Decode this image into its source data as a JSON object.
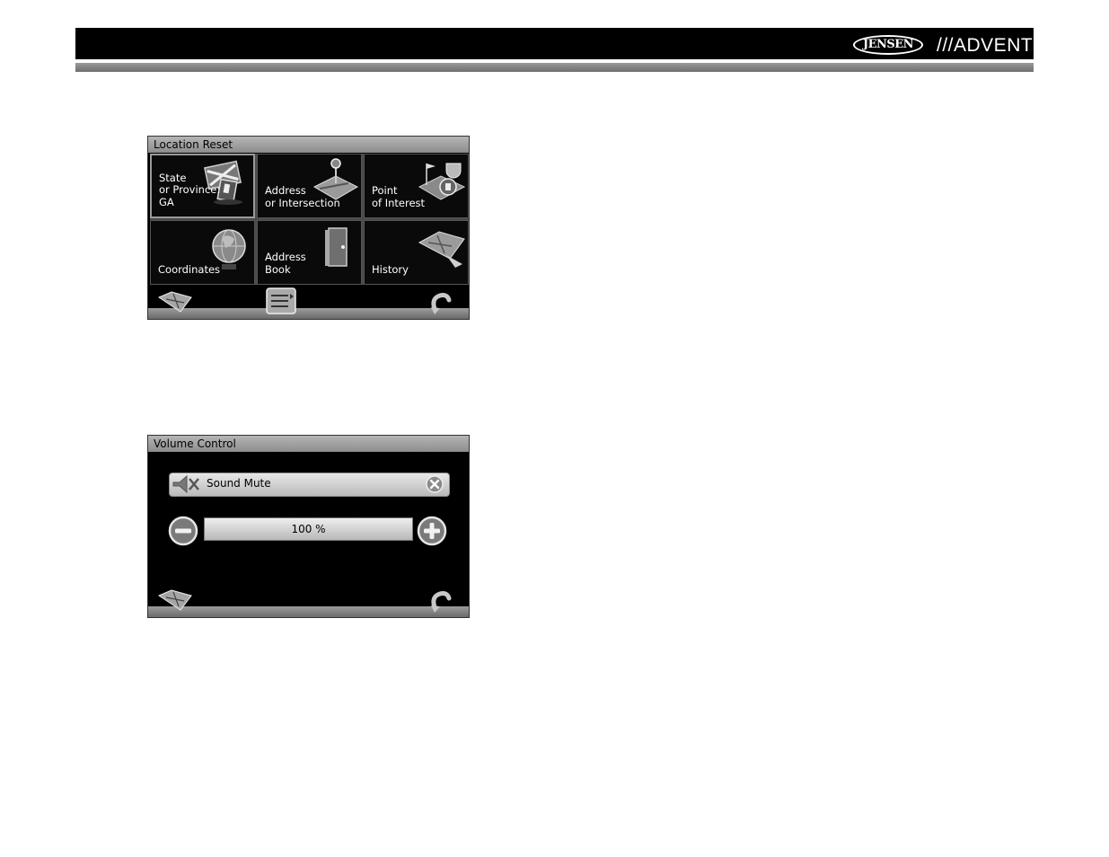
{
  "header": {
    "brand_left": "JENSEN",
    "brand_right": "///ADVENT"
  },
  "location_reset": {
    "title": "Location Reset",
    "tiles": [
      {
        "label": "State\nor Province:\nGA",
        "icon": "flag-icon",
        "selected": true
      },
      {
        "label": "Address\nor Intersection",
        "icon": "map-pin-icon",
        "selected": false
      },
      {
        "label": "Point\nof Interest",
        "icon": "poi-icon",
        "selected": false
      },
      {
        "label": "Coordinates",
        "icon": "globe-icon",
        "selected": false
      },
      {
        "label": "Address\nBook",
        "icon": "book-icon",
        "selected": false
      },
      {
        "label": "History",
        "icon": "map-history-icon",
        "selected": false
      }
    ],
    "bottom_icons": [
      "map-icon",
      "list-icon",
      "back-arrow-icon"
    ]
  },
  "volume_control": {
    "title": "Volume Control",
    "mute_label": "Sound Mute",
    "volume_text": "100 %",
    "volume_level_percent": 100,
    "bottom_icons": [
      "map-icon",
      "back-arrow-icon"
    ]
  }
}
